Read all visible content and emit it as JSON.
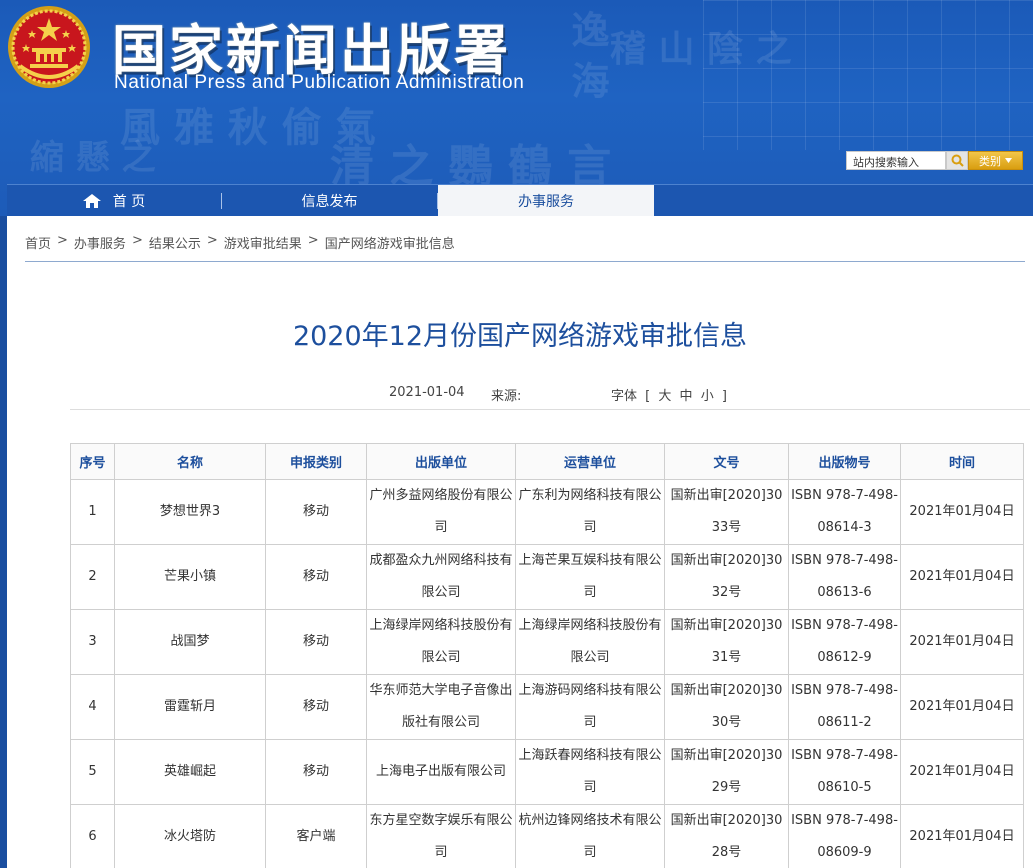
{
  "header": {
    "title": "国家新闻出版署",
    "subtitle": "National Press and Publication Administration",
    "emblem_icon": "national-emblem-icon",
    "search_placeholder": "站内搜索输入",
    "search_icon": "search-icon",
    "category_label": "类别",
    "colors": {
      "banner": "#1f63c2",
      "accent": "#d99e10"
    }
  },
  "nav": {
    "items": [
      {
        "label": "首 页",
        "icon": "home-icon"
      },
      {
        "label": "信息发布"
      },
      {
        "label": "办事服务",
        "active": true
      }
    ]
  },
  "breadcrumb": [
    "首页",
    "办事服务",
    "结果公示",
    "游戏审批结果",
    "国产网络游戏审批信息"
  ],
  "breadcrumb_separator": ">",
  "article": {
    "title": "2020年12月份国产网络游戏审批信息",
    "date": "2021-01-04",
    "source_label": "来源:",
    "font_label": "字体",
    "font_sizes": [
      "大",
      "中",
      "小"
    ],
    "font_open": "[",
    "font_close": "]"
  },
  "table": {
    "headers": [
      "序号",
      "名称",
      "申报类别",
      "出版单位",
      "运营单位",
      "文号",
      "出版物号",
      "时间"
    ],
    "rows": [
      [
        "1",
        "梦想世界3",
        "移动",
        "广州多益网络股份有限公司",
        "广东利为网络科技有限公司",
        "国新出审[2020]3033号",
        "ISBN 978-7-498-08614-3",
        "2021年01月04日"
      ],
      [
        "2",
        "芒果小镇",
        "移动",
        "成都盈众九州网络科技有限公司",
        "上海芒果互娱科技有限公司",
        "国新出审[2020]3032号",
        "ISBN 978-7-498-08613-6",
        "2021年01月04日"
      ],
      [
        "3",
        "战国梦",
        "移动",
        "上海绿岸网络科技股份有限公司",
        "上海绿岸网络科技股份有限公司",
        "国新出审[2020]3031号",
        "ISBN 978-7-498-08612-9",
        "2021年01月04日"
      ],
      [
        "4",
        "雷霆斩月",
        "移动",
        "华东师范大学电子音像出版社有限公司",
        "上海游码网络科技有限公司",
        "国新出审[2020]3030号",
        "ISBN 978-7-498-08611-2",
        "2021年01月04日"
      ],
      [
        "5",
        "英雄崛起",
        "移动",
        "上海电子出版有限公司",
        "上海跃春网络科技有限公司",
        "国新出审[2020]3029号",
        "ISBN 978-7-498-08610-5",
        "2021年01月04日"
      ],
      [
        "6",
        "冰火塔防",
        "客户端",
        "东方星空数字娱乐有限公司",
        "杭州边锋网络技术有限公司",
        "国新出审[2020]3028号",
        "ISBN 978-7-498-08609-9",
        "2021年01月04日"
      ]
    ]
  }
}
